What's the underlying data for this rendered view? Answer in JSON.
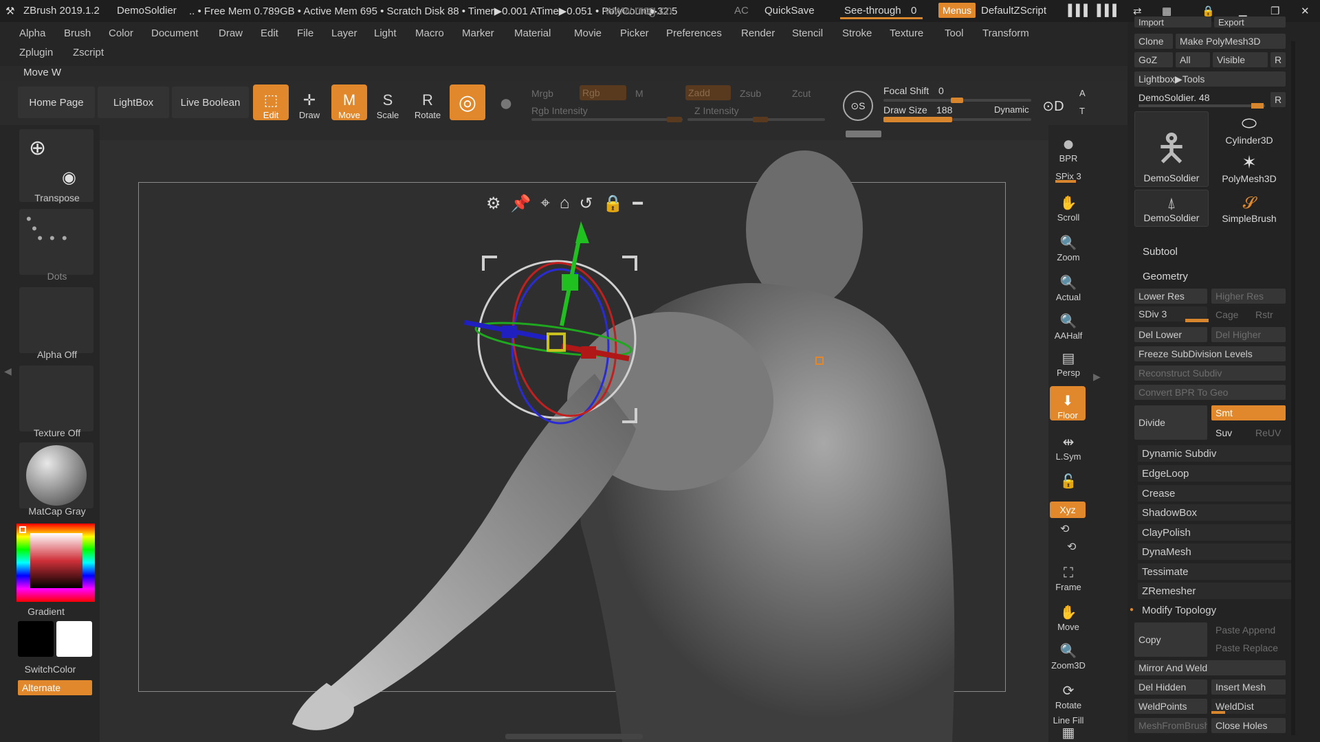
{
  "titlebar": {
    "app": "ZBrush 2019.1.2",
    "doc": "DemoSoldier",
    "stats": ".. • Free Mem 0.789GB • Active Mem 695 • Scratch Disk 88 • Timer▶0.001 ATime▶0.051 • PolyCount▶32.5",
    "ac": "AC",
    "quicksave": "QuickSave",
    "seethrough_label": "See-through",
    "seethrough_value": "0",
    "menus": "Menus",
    "script": "DefaultZScript",
    "watermark": "www.rrcg.cn"
  },
  "menus": {
    "row1": [
      "Alpha",
      "Brush",
      "Color",
      "Document",
      "Draw",
      "Edit",
      "File",
      "Layer",
      "Light",
      "Macro",
      "Marker",
      "Material",
      "Movie",
      "Picker",
      "Preferences",
      "Render",
      "Stencil",
      "Stroke",
      "Texture",
      "Tool",
      "Transform"
    ],
    "row2": [
      "Zplugin",
      "Zscript"
    ]
  },
  "mode_label": "Move W",
  "toolbar": {
    "home": "Home Page",
    "lightbox": "LightBox",
    "liveboolean": "Live Boolean",
    "edit": "Edit",
    "draw": "Draw",
    "move": "Move",
    "scale": "Scale",
    "rotate": "Rotate",
    "mrgb": "Mrgb",
    "rgb": "Rgb",
    "m": "M",
    "rgb_intensity": "Rgb Intensity",
    "zadd": "Zadd",
    "zsub": "Zsub",
    "zcut": "Zcut",
    "z_intensity": "Z Intensity",
    "focal_shift_label": "Focal Shift",
    "focal_shift_value": "0",
    "draw_size_label": "Draw Size",
    "draw_size_value": "188",
    "dynamic": "Dynamic"
  },
  "lefttray": {
    "transpose": "Transpose",
    "dots": "Dots",
    "alpha": "Alpha Off",
    "texture": "Texture Off",
    "matcap": "MatCap Gray",
    "gradient": "Gradient",
    "switchcolor": "SwitchColor",
    "alternate": "Alternate"
  },
  "rightshelf": [
    "BPR",
    "SPix 3",
    "Scroll",
    "Zoom",
    "Actual",
    "AAHalf",
    "Persp",
    "Floor",
    "L.Sym",
    "Xyz",
    "Frame",
    "Move",
    "Zoom3D",
    "Rotate",
    "Line Fill"
  ],
  "rightpanel": {
    "import": "Import",
    "export": "Export",
    "clone": "Clone",
    "make_polymesh": "Make PolyMesh3D",
    "goz": "GoZ",
    "all": "All",
    "visible": "Visible",
    "r": "R",
    "lightbox_tools": "Lightbox▶Tools",
    "current_tool": "DemoSoldier. 48",
    "thumbs": [
      "DemoSoldier",
      "Cylinder3D",
      "PolyMesh3D",
      "DemoSoldier",
      "SimpleBrush"
    ],
    "subtool": "Subtool",
    "geometry": "Geometry",
    "lower_res": "Lower Res",
    "higher_res": "Higher Res",
    "sdiv": "SDiv 3",
    "cage": "Cage",
    "rstr": "Rstr",
    "del_lower": "Del Lower",
    "del_higher": "Del Higher",
    "freeze": "Freeze SubDivision Levels",
    "reconstruct": "Reconstruct Subdiv",
    "convert_bpr": "Convert BPR To Geo",
    "divide": "Divide",
    "smt": "Smt",
    "suv": "Suv",
    "reuv": "ReUV",
    "sections": [
      "Dynamic Subdiv",
      "EdgeLoop",
      "Crease",
      "ShadowBox",
      "ClayPolish",
      "DynaMesh",
      "Tessimate",
      "ZRemesher",
      "Modify Topology"
    ],
    "copy": "Copy",
    "paste_append": "Paste Append",
    "paste_replace": "Paste Replace",
    "mirror_weld": "Mirror And Weld",
    "del_hidden": "Del Hidden",
    "insert_mesh": "Insert Mesh",
    "weldpoints": "WeldPoints",
    "welddist": "WeldDist",
    "meshfrombrush": "MeshFromBrush",
    "close_holes": "Close Holes"
  },
  "colors": {
    "accent": "#e0882b",
    "panel": "#232323",
    "viewport": "#2f2f2f"
  }
}
